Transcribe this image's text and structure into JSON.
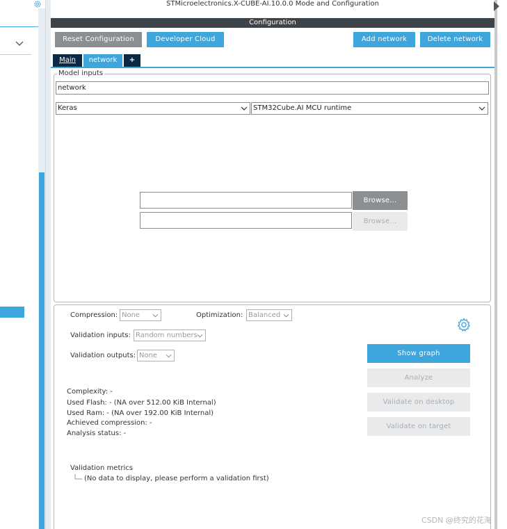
{
  "window": {
    "title": "STMicroelectronics.X-CUBE-AI.10.0.0 Mode and Configuration"
  },
  "config_bar": {
    "label": "Configuration"
  },
  "toolbar": {
    "reset_label": "Reset Configuration",
    "developer_cloud_label": "Developer Cloud",
    "add_network_label": "Add network",
    "delete_network_label": "Delete network"
  },
  "tabs": [
    {
      "label": "Main"
    },
    {
      "label": "network"
    },
    {
      "label": "+"
    }
  ],
  "model_inputs": {
    "legend": "Model inputs",
    "name_value": "network",
    "framework_value": "Keras",
    "runtime_value": "STM32Cube.AI MCU runtime",
    "model_path_value": "",
    "weights_path_value": "",
    "browse1_label": "Browse...",
    "browse2_label": "Browse..."
  },
  "settings": {
    "compression_label": "Compression:",
    "compression_value": "None",
    "optimization_label": "Optimization:",
    "optimization_value": "Balanced",
    "validation_inputs_label": "Validation inputs:",
    "validation_inputs_value": "Random numbers",
    "validation_outputs_label": "Validation outputs:",
    "validation_outputs_value": "None"
  },
  "actions": {
    "show_graph_label": "Show graph",
    "analyze_label": "Analyze",
    "validate_desktop_label": "Validate on desktop",
    "validate_target_label": "Validate on target"
  },
  "analysis": {
    "complexity": "Complexity: -",
    "used_flash": "Used Flash: - (NA over 512.00 KiB Internal)",
    "used_ram": "Used Ram: - (NA over 192.00 KiB Internal)",
    "achieved_compression": "Achieved compression: -",
    "analysis_status": "Analysis status: -"
  },
  "validation_metrics": {
    "title": "Validation metrics",
    "empty_message": "(No data to display, please perform a validation first)"
  },
  "watermark": "CSDN @终究的花海",
  "colors": {
    "accent": "#3ea6dc",
    "dark_tab": "#0b2947",
    "header_bar": "#3e4347",
    "gray_button": "#8c8f92"
  }
}
